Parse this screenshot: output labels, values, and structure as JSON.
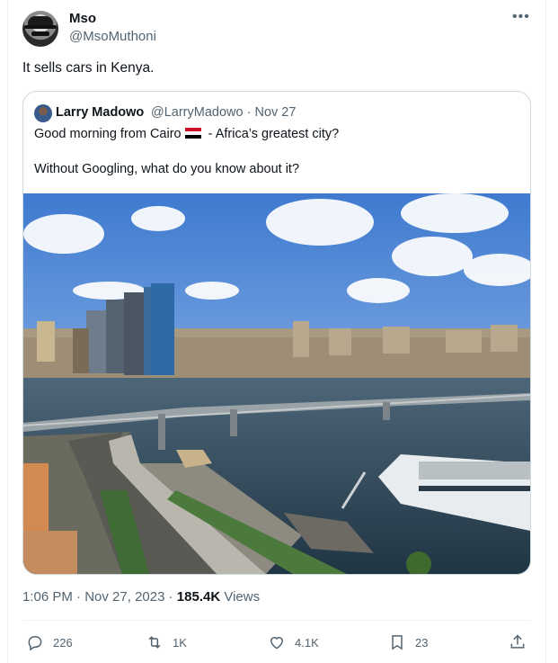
{
  "author": {
    "display_name": "Mso",
    "handle": "@MsoMuthoni",
    "more_icon": "more-horizontal-icon"
  },
  "tweet": {
    "text": "It sells cars in Kenya.",
    "time": "1:06 PM",
    "date": "Nov 27, 2023",
    "views_count": "185.4K",
    "views_label": "Views",
    "sep": "·"
  },
  "quote": {
    "display_name": "Larry Madowo",
    "handle": "@LarryMadowo",
    "date": "Nov 27",
    "sep": "·",
    "line1_before": "Good morning from Cairo",
    "line1_after": "- Africa’s greatest city?",
    "line2": "Without Googling, what do you know about it?"
  },
  "actions": {
    "replies": "226",
    "retweets": "1K",
    "likes": "4.1K",
    "bookmarks": "23"
  },
  "colors": {
    "text": "#0f1419",
    "secondary": "#536471",
    "border": "#cfd9de"
  }
}
